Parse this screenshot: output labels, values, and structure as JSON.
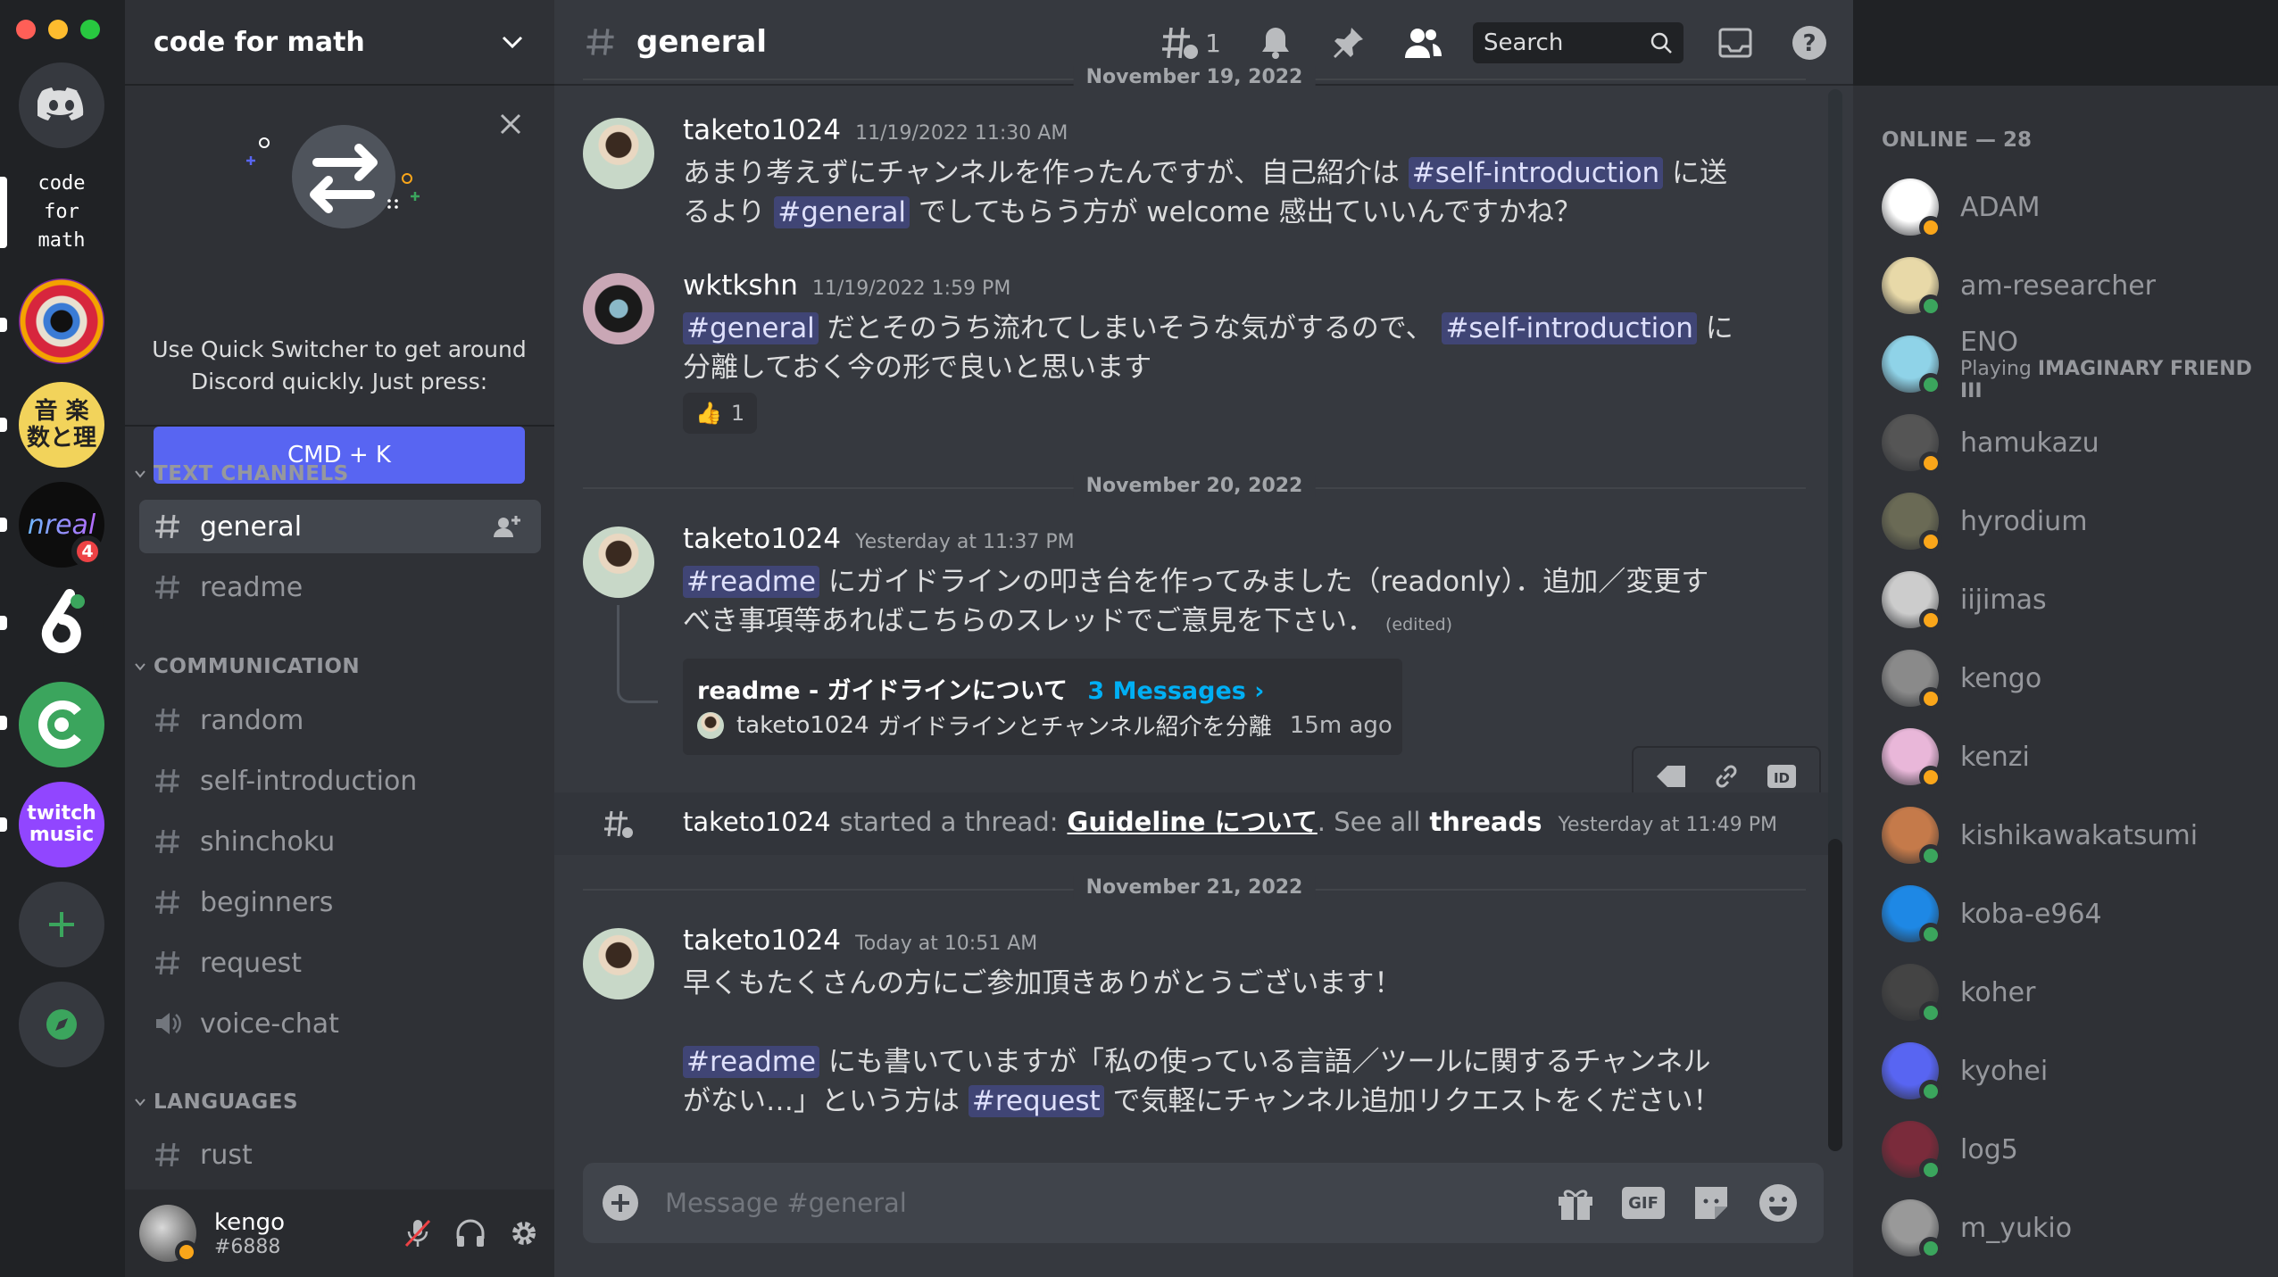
{
  "window": {
    "traffic_colors": {
      "close": "#ff5f57",
      "minimize": "#febc2e",
      "maximize": "#28c840"
    }
  },
  "servers": [
    {
      "name": "home",
      "icon": "discord-logo-icon"
    },
    {
      "name": "code for math",
      "label_lines": [
        "code",
        "for",
        "math"
      ],
      "active": true
    },
    {
      "name": "eye-art-server",
      "icon": "eye-art-icon"
    },
    {
      "name": "oto to suuri",
      "label_lines": [
        "音 楽",
        "数と理"
      ]
    },
    {
      "name": "nreal",
      "label": "nreal",
      "badge": "4"
    },
    {
      "name": "six-server",
      "icon": "six-icon"
    },
    {
      "name": "green-server",
      "icon": "green-c-icon"
    },
    {
      "name": "twitch music",
      "label_lines": [
        "twitch",
        "music"
      ]
    },
    {
      "name": "add-server",
      "icon": "plus-icon"
    },
    {
      "name": "explore",
      "icon": "compass-icon"
    }
  ],
  "guild": {
    "name": "code for math"
  },
  "quick_switcher": {
    "text": "Use Quick Switcher to get around Discord quickly. Just press:",
    "button": "CMD + K"
  },
  "categories": {
    "text": "TEXT CHANNELS",
    "communication": "COMMUNICATION",
    "languages": "LANGUAGES"
  },
  "channels": {
    "general": "general",
    "readme": "readme",
    "random": "random",
    "self_intro": "self-introduction",
    "shinchoku": "shinchoku",
    "beginners": "beginners",
    "request": "request",
    "voice": "voice-chat",
    "rust": "rust"
  },
  "user": {
    "name": "kengo",
    "tag": "#6888"
  },
  "topbar": {
    "channel": "general",
    "thread_count": "1",
    "search_placeholder": "Search"
  },
  "messages": {
    "partial_date": "November 19, 2022",
    "m1": {
      "author": "taketo1024",
      "time": "11/19/2022 11:30 AM",
      "l1a": "あまり考えずにチャンネルを作ったんですが、自己紹介は",
      "l1_mention": "#self-introduction",
      "l1b": "に送",
      "l2a": "るより",
      "l2_mention": "#general",
      "l2b": "でしてもらう方が welcome 感出ていいんですかね？"
    },
    "m2": {
      "author": "wktkshn",
      "time": "11/19/2022 1:59 PM",
      "l1_mention1": "#general",
      "l1a": "だとそのうち流れてしまいそうな気がするので、",
      "l1_mention2": "#self-introduction",
      "l1b": "に",
      "l2": "分離しておく今の形で良いと思います",
      "reaction_emoji": "👍",
      "reaction_count": "1"
    },
    "date2": "November 20, 2022",
    "m3": {
      "author": "taketo1024",
      "time": "Yesterday at 11:37 PM",
      "l1_mention": "#readme",
      "l1a": "にガイドラインの叩き台を作ってみました（readonly）．追加／変更す",
      "l2": "べき事項等あればこちらのスレッドでご意見を下さい．",
      "edited": "(edited)",
      "thread_title": "readme - ガイドラインについて",
      "thread_count": "3 Messages ›",
      "thread_author": "taketo1024",
      "thread_last": "ガイドラインとチャンネル紹介を分離",
      "thread_ago": "15m ago"
    },
    "sys": {
      "author": "taketo1024",
      "started": "started a thread:",
      "thread": "Guideline について",
      "see_all": ". See all",
      "threads": "threads",
      "time": "Yesterday at 11:49 PM"
    },
    "date3": "November 21, 2022",
    "m4": {
      "author": "taketo1024",
      "time": "Today at 10:51 AM",
      "l1": "早くもたくさんの方にご参加頂きありがとうございます！",
      "l2_mention": "#readme",
      "l2a": "にも書いていますが「私の使っている言語／ツールに関するチャンネル",
      "l3a": "がない…」という方は",
      "l3_mention": "#request",
      "l3b": "で気軽にチャンネル追加リクエストをください！"
    }
  },
  "composer": {
    "placeholder": "Message #general",
    "gif": "GIF"
  },
  "members": {
    "header": "ONLINE — 28",
    "list": [
      {
        "name": "ADAM",
        "status": "idle",
        "color": "#fff"
      },
      {
        "name": "am-researcher",
        "status": "online",
        "color": "#e8d9a8"
      },
      {
        "name": "ENO",
        "status": "online",
        "color": "#8fd3e8",
        "activity_prefix": "Playing ",
        "activity": "IMAGINARY FRIEND III"
      },
      {
        "name": "hamukazu",
        "status": "idle",
        "color": "#555"
      },
      {
        "name": "hyrodium",
        "status": "idle",
        "color": "#6a6a55"
      },
      {
        "name": "iijimas",
        "status": "idle",
        "color": "#ccc"
      },
      {
        "name": "kengo",
        "status": "idle",
        "color": "#8a8a8a"
      },
      {
        "name": "kenzi",
        "status": "idle",
        "color": "#e9b7d9"
      },
      {
        "name": "kishikawakatsumi",
        "status": "online",
        "color": "#c57a4a"
      },
      {
        "name": "koba-e964",
        "status": "online",
        "color": "#1e88e5"
      },
      {
        "name": "koher",
        "status": "online",
        "color": "#444"
      },
      {
        "name": "kyohei",
        "status": "online",
        "color": "#5865f2"
      },
      {
        "name": "log5",
        "status": "online",
        "color": "#7a2b3b"
      },
      {
        "name": "m_yukio",
        "status": "online",
        "color": "#999"
      }
    ]
  }
}
